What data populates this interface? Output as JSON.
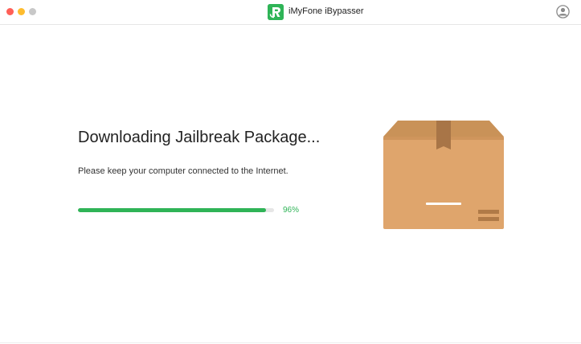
{
  "window": {
    "title": "iMyFone iBypasser",
    "controls": {
      "close": "close",
      "minimize": "minimize",
      "maximize": "maximize"
    },
    "account_icon": "user-circle-icon",
    "logo_icon": "ibypasser-logo-icon"
  },
  "main": {
    "heading": "Downloading Jailbreak Package...",
    "subtext": "Please keep your computer connected to the Internet.",
    "progress": {
      "value": 0.96,
      "label": "96%"
    },
    "illustration_icon": "package-box-icon"
  },
  "colors": {
    "accent": "#2fb457",
    "traffic_close": "#ff5f57",
    "traffic_min": "#febc2e",
    "traffic_max": "#c8c8c8",
    "box_main": "#dfa56c"
  }
}
